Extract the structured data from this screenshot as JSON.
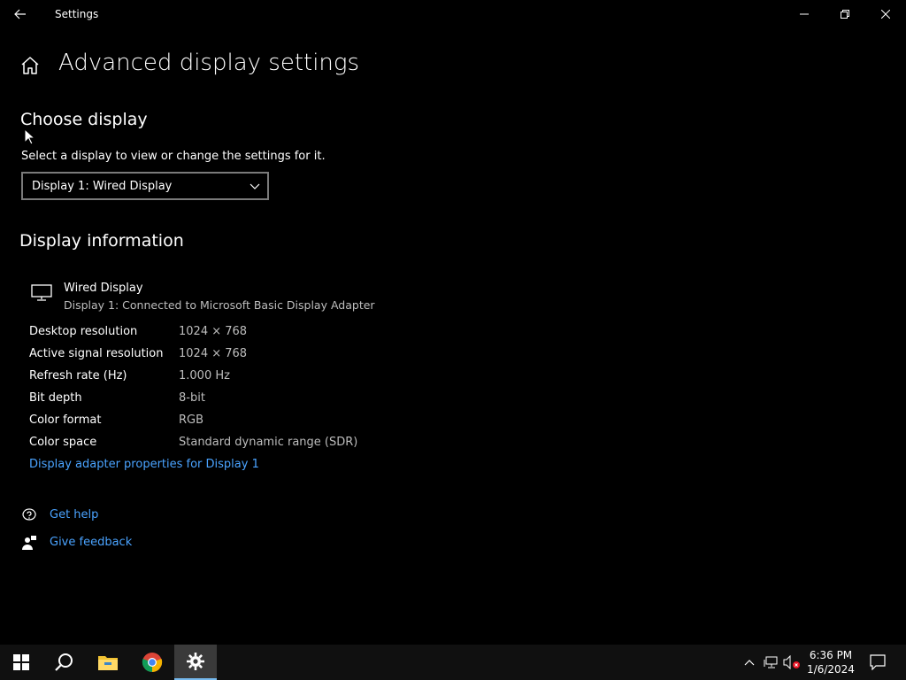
{
  "window": {
    "app_title": "Settings",
    "controls": [
      "minimize",
      "restore",
      "close"
    ]
  },
  "page": {
    "title": "Advanced display settings"
  },
  "choose_display": {
    "heading": "Choose display",
    "description": "Select a display to view or change the settings for it.",
    "selected": "Display 1: Wired Display"
  },
  "display_info": {
    "heading": "Display information",
    "device_name": "Wired Display",
    "device_subtitle": "Display 1: Connected to Microsoft Basic Display Adapter",
    "rows": [
      {
        "label": "Desktop resolution",
        "value": "1024 × 768"
      },
      {
        "label": "Active signal resolution",
        "value": "1024 × 768"
      },
      {
        "label": "Refresh rate (Hz)",
        "value": "1.000 Hz"
      },
      {
        "label": "Bit depth",
        "value": "8-bit"
      },
      {
        "label": "Color format",
        "value": "RGB"
      },
      {
        "label": "Color space",
        "value": "Standard dynamic range (SDR)"
      }
    ],
    "adapter_link": "Display adapter properties for Display 1"
  },
  "help": {
    "get_help": "Get help",
    "give_feedback": "Give feedback"
  },
  "taskbar": {
    "time": "6:36 PM",
    "date": "1/6/2024",
    "pinned": [
      "start-icon",
      "search-icon",
      "file-explorer-icon",
      "chrome-icon",
      "settings-icon"
    ],
    "tray": [
      "chevron-up-icon",
      "network-icon",
      "volume-muted-icon",
      "notification-icon"
    ]
  },
  "colors": {
    "background": "#000000",
    "link": "#4aa3ff",
    "secondary_text": "#bdbdbd",
    "taskbar": "#101010"
  }
}
